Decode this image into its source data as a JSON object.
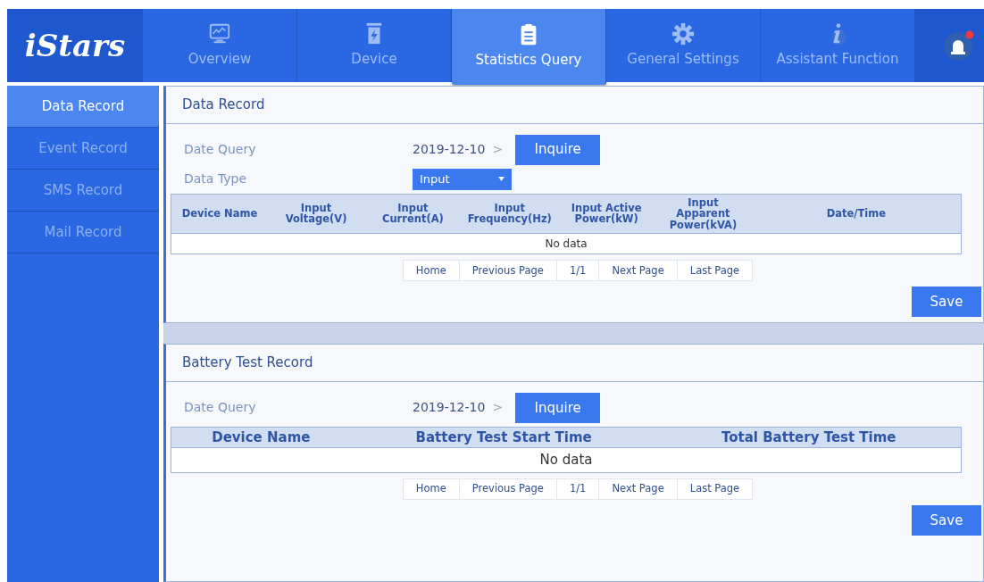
{
  "logo": "iStars",
  "nav": [
    {
      "label": "Overview",
      "selected": false
    },
    {
      "label": "Device",
      "selected": false
    },
    {
      "label": "Statistics Query",
      "selected": true
    },
    {
      "label": "General Settings",
      "selected": false
    },
    {
      "label": "Assistant Function",
      "selected": false
    }
  ],
  "alarm": {
    "active": true
  },
  "sidebar": {
    "items": [
      {
        "label": "Data Record",
        "selected": true
      },
      {
        "label": "Event Record",
        "selected": false
      },
      {
        "label": "SMS Record",
        "selected": false
      },
      {
        "label": "Mail Record",
        "selected": false
      }
    ]
  },
  "panels": [
    {
      "title": "Data Record",
      "fields": [
        {
          "kind": "date",
          "label": "Date Query",
          "value": "2019-12-10",
          "chevron": ">",
          "button": "Inquire"
        },
        {
          "kind": "select",
          "label": "Data Type",
          "value": "Input"
        }
      ],
      "table": {
        "columns": [
          "Device Name",
          "Input Voltage(V)",
          "Input Current(A)",
          "Input Frequency(Hz)",
          "Input Active Power(kW)",
          "Input Apparent Power(kVA)",
          "Date/Time"
        ],
        "empty": "No data"
      },
      "pager": [
        "Home",
        "Previous Page",
        "1/1",
        "Next Page",
        "Last Page"
      ],
      "save": "Save"
    },
    {
      "title": "Battery Test Record",
      "fields": [
        {
          "kind": "date",
          "label": "Date Query",
          "value": "2019-12-10",
          "chevron": ">",
          "button": "Inquire"
        }
      ],
      "table": {
        "columns": [
          "Device Name",
          "Battery Test Start Time",
          "Total Battery Test Time"
        ],
        "empty": "No data"
      },
      "pager": [
        "Home",
        "Previous Page",
        "1/1",
        "Next Page",
        "Last Page"
      ],
      "save": "Save"
    }
  ]
}
